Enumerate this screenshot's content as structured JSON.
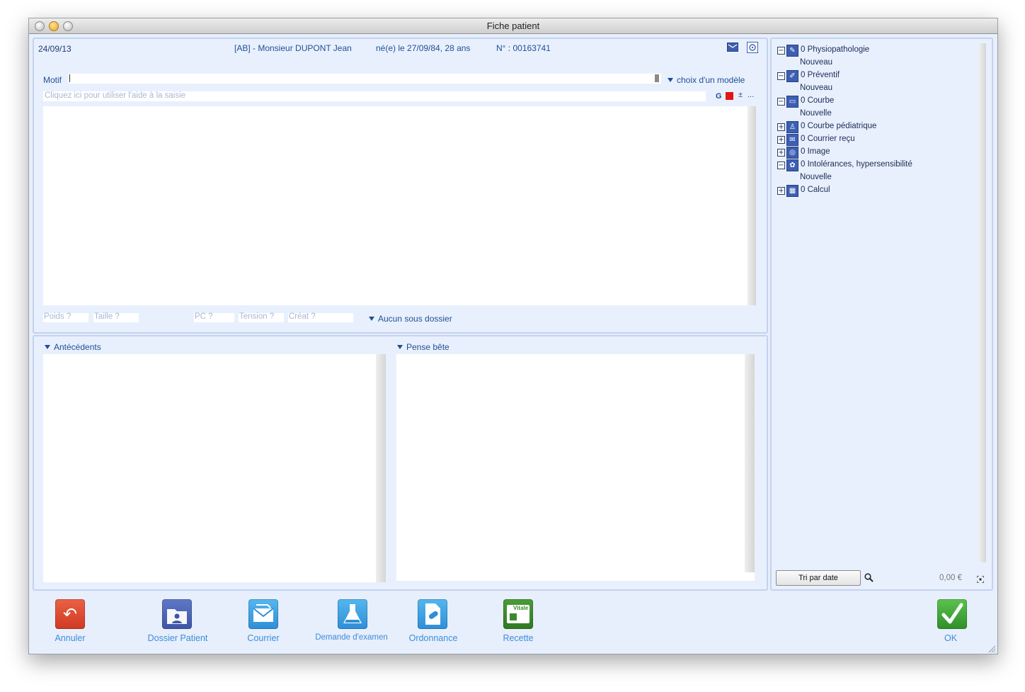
{
  "window": {
    "title": "Fiche patient"
  },
  "header": {
    "date": "24/09/13",
    "patient": "[AB] - Monsieur DUPONT  Jean",
    "birth": "né(e) le 27/09/84, 28 ans",
    "number": "N° : 00163741"
  },
  "consultation": {
    "motif_label": "Motif",
    "model_choice": "choix d'un modèle",
    "help_placeholder": "Cliquez ici pour utiliser l'aide à la saisie",
    "format_g": "G",
    "format_plus": "±",
    "format_more": "...",
    "vitals": {
      "poids": "Poids ?",
      "taille": "Taille ?",
      "pc": "PC ?",
      "tension": "Tension ?",
      "creat": "Créat ?"
    },
    "subfolder": "Aucun sous dossier"
  },
  "lower": {
    "antecedents_label": "Antécédents",
    "pense_bete_label": "Pense bête"
  },
  "tree": {
    "items": [
      {
        "label": "0 Physiopathologie",
        "expander": "−",
        "sub": "Nouveau",
        "icon": "pen-icon"
      },
      {
        "label": "0 Préventif",
        "expander": "−",
        "sub": "Nouveau",
        "icon": "syringe-icon"
      },
      {
        "label": "0 Courbe",
        "expander": "−",
        "sub": "Nouvelle",
        "icon": "chart-icon"
      },
      {
        "label": "0 Courbe pédiatrique",
        "expander": "+",
        "icon": "child-icon"
      },
      {
        "label": "0 Courrier reçu",
        "expander": "+",
        "icon": "mail-in-icon"
      },
      {
        "label": "0 Image",
        "expander": "+",
        "icon": "camera-icon"
      },
      {
        "label": "0 Intolérances, hypersensibilité",
        "expander": "−",
        "sub": "Nouvelle",
        "icon": "allergy-icon"
      },
      {
        "label": "0 Calcul",
        "expander": "+",
        "icon": "calculator-icon"
      }
    ],
    "sort_button": "Tri par date",
    "amount": "0,00 €"
  },
  "toolbar": {
    "annuler": "Annuler",
    "dossier": "Dossier Patient",
    "courrier": "Courrier",
    "examen": "Demande d'examen",
    "ordonnance": "Ordonnance",
    "recette": "Recette",
    "vitale": "Vitale",
    "ok": "OK"
  },
  "colors": {
    "panel_bg": "#e9f0fd",
    "label_blue": "#1e4f96",
    "annuler_red": "#dc4a32",
    "folder_blue": "#4a63b6",
    "action_blue": "#3ea3e6",
    "recette_green": "#3a8a2c",
    "ok_green": "#3fa83a"
  }
}
